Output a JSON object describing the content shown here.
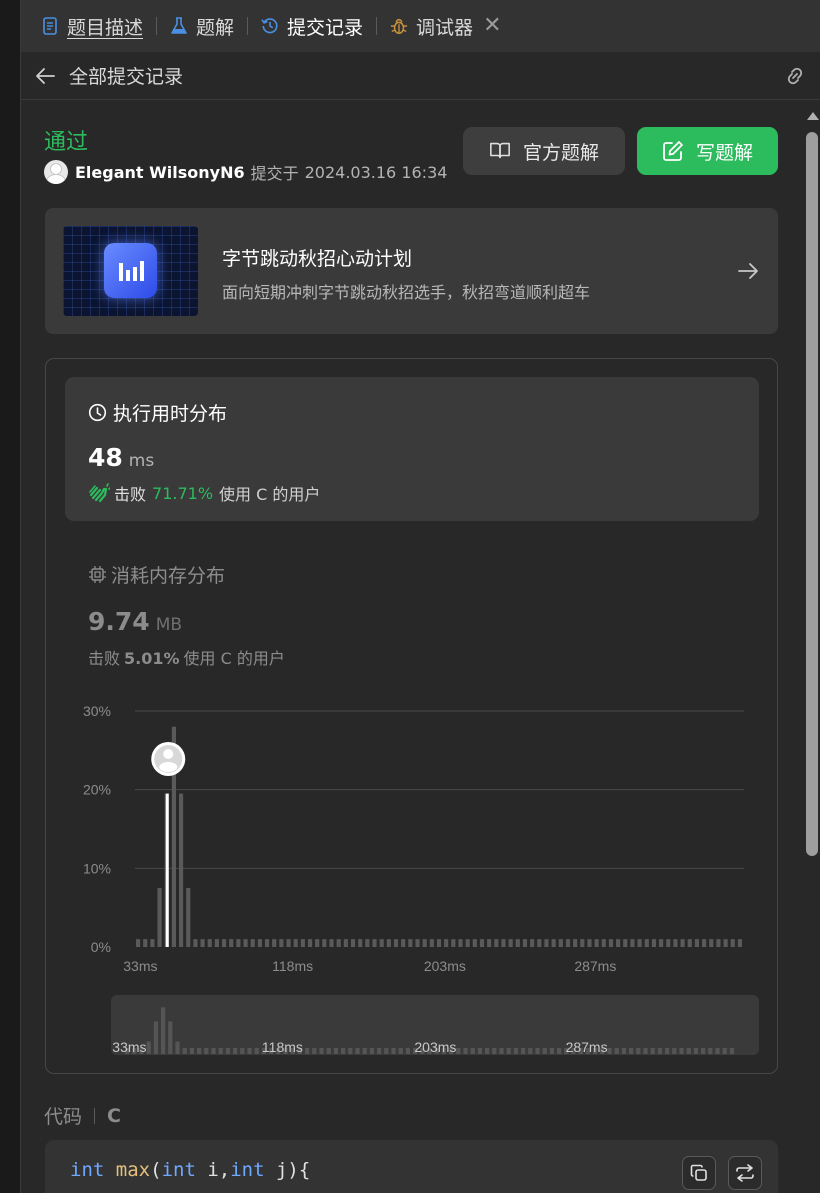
{
  "tabs": [
    {
      "label": "题目描述",
      "icon": "document-icon"
    },
    {
      "label": "题解",
      "icon": "flask-icon"
    },
    {
      "label": "提交记录",
      "icon": "history-icon",
      "active": true
    },
    {
      "label": "调试器",
      "icon": "bug-icon"
    }
  ],
  "subheader": {
    "title": "全部提交记录"
  },
  "submission": {
    "status": "通过",
    "author": "Elegant WilsonyN6",
    "submitted_prefix": "提交于",
    "submitted_at": "2024.03.16 16:34",
    "official_solution_label": "官方题解",
    "write_solution_label": "写题解"
  },
  "banner": {
    "title": "字节跳动秋招心动计划",
    "subtitle": "面向短期冲刺字节跳动秋招选手，秋招弯道顺利超车"
  },
  "runtime": {
    "heading": "执行用时分布",
    "value": "48",
    "unit": "ms",
    "beat_prefix": "击败",
    "beat_percent": "71.71%",
    "beat_suffix": "使用 C 的用户"
  },
  "memory": {
    "heading": "消耗内存分布",
    "value": "9.74",
    "unit": "MB",
    "beat_prefix": "击败",
    "beat_percent": "5.01%",
    "beat_suffix": "使用 C 的用户"
  },
  "colors": {
    "accent_green": "#2cbb5d",
    "bar": "#5a5a5a",
    "highlight_bar": "#ffffff",
    "link_blue": "#4a90e2"
  },
  "chart_data": {
    "type": "bar",
    "title": "",
    "xlabel": "",
    "ylabel": "",
    "ylim": [
      0,
      30
    ],
    "y_ticks": [
      "30%",
      "20%",
      "10%",
      "0%"
    ],
    "x_ticks": [
      "33ms",
      "118ms",
      "203ms",
      "287ms"
    ],
    "x_tick_values": [
      33,
      118,
      203,
      287
    ],
    "x_range": [
      30,
      370
    ],
    "bin_width": 4,
    "highlight_x": 48,
    "highlight_value": 19.5,
    "values": [
      1,
      1,
      1,
      7.5,
      19.5,
      28,
      19.5,
      7.5,
      1,
      1,
      1,
      1,
      1,
      1,
      1,
      1,
      1,
      1,
      1,
      1,
      1,
      1,
      1,
      1,
      1,
      1,
      1,
      1,
      1,
      1,
      1,
      1,
      1,
      1,
      1,
      1,
      1,
      1,
      1,
      1,
      1,
      1,
      1,
      1,
      1,
      1,
      1,
      1,
      1,
      1,
      1,
      1,
      1,
      1,
      1,
      1,
      1,
      1,
      1,
      1,
      1,
      1,
      1,
      1,
      1,
      1,
      1,
      1,
      1,
      1,
      1,
      1,
      1,
      1,
      1,
      1,
      1,
      1,
      1,
      1,
      1,
      1,
      1,
      1,
      1
    ],
    "grid": true
  },
  "code": {
    "label": "代码",
    "language": "C",
    "first_line": {
      "kw1": "int",
      "fn": "max",
      "kw2": "int",
      "mid": " i,",
      "kw3": "int",
      "end": " j){"
    }
  }
}
